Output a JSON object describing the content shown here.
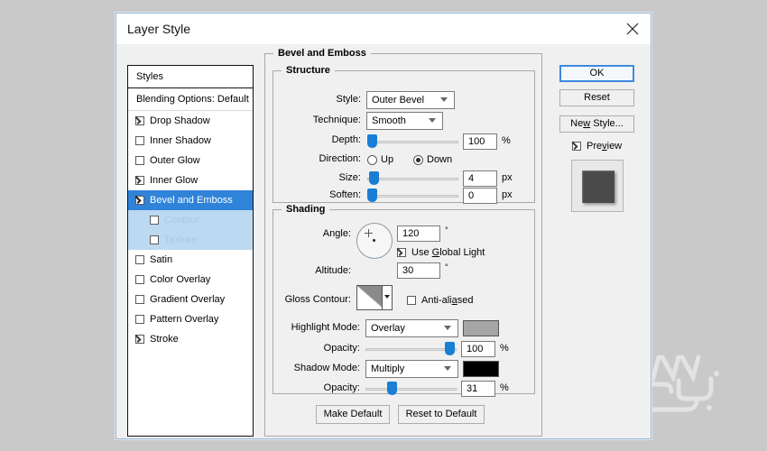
{
  "window": {
    "title": "Layer Style",
    "close_icon": "close-icon"
  },
  "styles_panel": {
    "header": "Styles",
    "blending_options": "Blending Options: Default",
    "effects": [
      {
        "label": "Drop Shadow",
        "checked": true,
        "selected": false,
        "sub": false
      },
      {
        "label": "Inner Shadow",
        "checked": false,
        "selected": false,
        "sub": false
      },
      {
        "label": "Outer Glow",
        "checked": false,
        "selected": false,
        "sub": false
      },
      {
        "label": "Inner Glow",
        "checked": true,
        "selected": false,
        "sub": false
      },
      {
        "label": "Bevel and Emboss",
        "checked": true,
        "selected": true,
        "sub": false
      },
      {
        "label": "Contour",
        "checked": false,
        "selected": false,
        "sub": true
      },
      {
        "label": "Texture",
        "checked": false,
        "selected": false,
        "sub": true
      },
      {
        "label": "Satin",
        "checked": false,
        "selected": false,
        "sub": false
      },
      {
        "label": "Color Overlay",
        "checked": false,
        "selected": false,
        "sub": false
      },
      {
        "label": "Gradient Overlay",
        "checked": false,
        "selected": false,
        "sub": false
      },
      {
        "label": "Pattern Overlay",
        "checked": false,
        "selected": false,
        "sub": false
      },
      {
        "label": "Stroke",
        "checked": true,
        "selected": false,
        "sub": false
      }
    ]
  },
  "main": {
    "panel_title": "Bevel and Emboss",
    "structure": {
      "title": "Structure",
      "style_label": "Style:",
      "style_value": "Outer Bevel",
      "technique_label": "Technique:",
      "technique_value": "Smooth",
      "depth_label": "Depth:",
      "depth_value": "100",
      "depth_unit": "%",
      "direction_label": "Direction:",
      "direction_up": "Up",
      "direction_down": "Down",
      "direction_selected": "Down",
      "size_label": "Size:",
      "size_value": "4",
      "size_unit": "px",
      "soften_label": "Soften:",
      "soften_value": "0",
      "soften_unit": "px"
    },
    "shading": {
      "title": "Shading",
      "angle_label": "Angle:",
      "angle_value": "120",
      "angle_unit": "°",
      "use_global_light": "Use Global Light",
      "use_global_light_checked": true,
      "altitude_label": "Altitude:",
      "altitude_value": "30",
      "altitude_unit": "°",
      "gloss_contour_label": "Gloss Contour:",
      "anti_aliased": "Anti-aliased",
      "anti_aliased_checked": false,
      "highlight_mode_label": "Highlight Mode:",
      "highlight_mode_value": "Overlay",
      "highlight_color": "#a5a5a5",
      "highlight_opacity_label": "Opacity:",
      "highlight_opacity_value": "100",
      "highlight_opacity_unit": "%",
      "shadow_mode_label": "Shadow Mode:",
      "shadow_mode_value": "Multiply",
      "shadow_color": "#000000",
      "shadow_opacity_label": "Opacity:",
      "shadow_opacity_value": "31",
      "shadow_opacity_unit": "%"
    },
    "make_default": "Make Default",
    "reset_to_default": "Reset to Default"
  },
  "actions": {
    "ok": "OK",
    "reset": "Reset",
    "new_style": "New Style...",
    "preview": "Preview",
    "preview_checked": true
  },
  "colors": {
    "selection_blue": "#2f83d9",
    "slider_blue": "#1a7fd4",
    "focus_blue": "#3c8adf",
    "dialog_bg": "#f0f0f0",
    "desktop_bg": "#c9c9c9"
  }
}
